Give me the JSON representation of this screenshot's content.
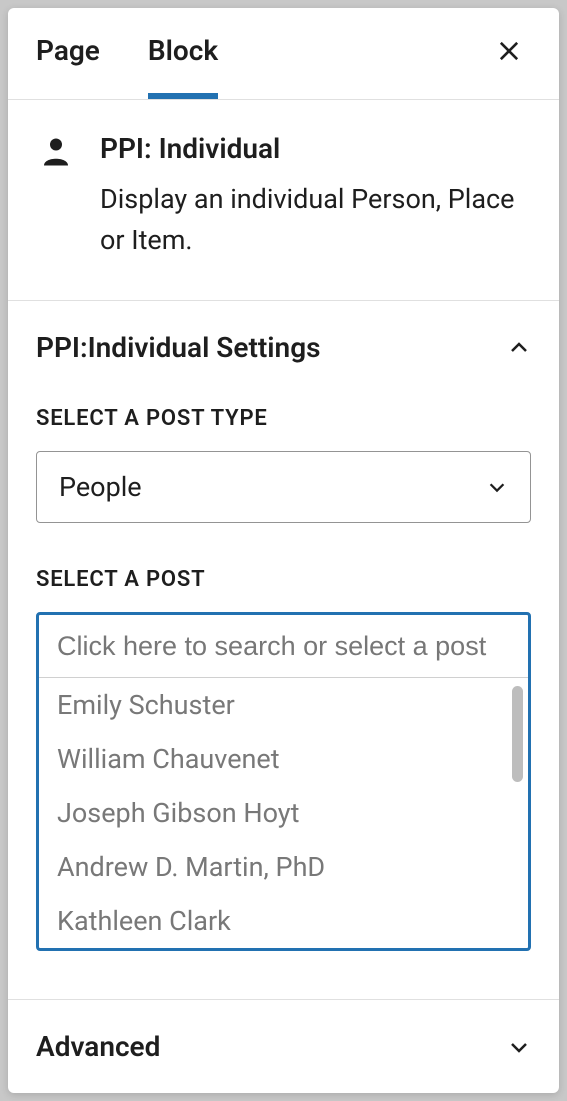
{
  "tabs": {
    "page": "Page",
    "block": "Block"
  },
  "block": {
    "title": "PPI: Individual",
    "description": "Display an individual Person, Place or Item."
  },
  "settings_section": {
    "title": "PPI:Individual Settings",
    "post_type": {
      "label": "Select a Post Type",
      "value": "People"
    },
    "post_select": {
      "label": "Select a Post",
      "placeholder": "Click here to search or select a post",
      "options": [
        "Emily Schuster",
        "William Chauvenet",
        "Joseph Gibson Hoyt",
        "Andrew D. Martin, PhD",
        "Kathleen Clark"
      ]
    }
  },
  "advanced_section": {
    "title": "Advanced"
  }
}
